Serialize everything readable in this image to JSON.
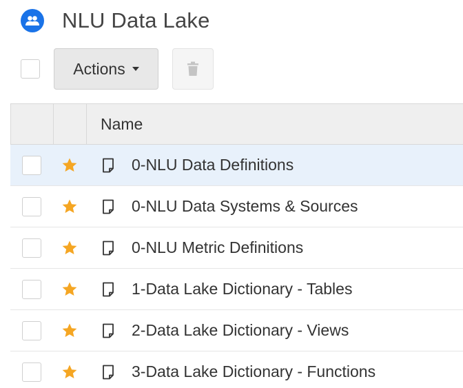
{
  "header": {
    "title": "NLU Data Lake",
    "icon": "group-icon",
    "icon_color": "#1a73e8"
  },
  "toolbar": {
    "actions_label": "Actions",
    "trash_icon": "trash-icon"
  },
  "table": {
    "columns": [
      "Name"
    ],
    "rows": [
      {
        "label": "0-NLU Data Definitions",
        "starred": true,
        "selected": true
      },
      {
        "label": "0-NLU Data Systems & Sources",
        "starred": true,
        "selected": false
      },
      {
        "label": "0-NLU Metric Definitions",
        "starred": true,
        "selected": false
      },
      {
        "label": "1-Data Lake Dictionary - Tables",
        "starred": true,
        "selected": false
      },
      {
        "label": "2-Data Lake Dictionary - Views",
        "starred": true,
        "selected": false
      },
      {
        "label": "3-Data Lake Dictionary - Functions",
        "starred": true,
        "selected": false
      }
    ]
  },
  "colors": {
    "star": "#f5a623",
    "selected_row": "#e8f1fb"
  }
}
